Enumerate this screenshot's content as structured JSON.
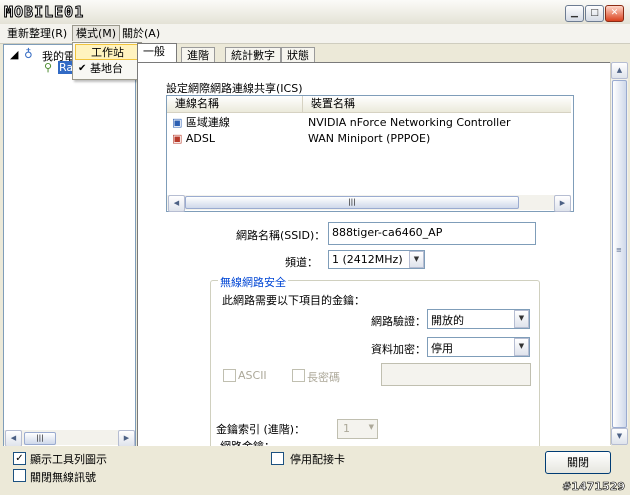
{
  "window": {
    "logo_text": "MOBILE01",
    "controls": [
      "minimize",
      "maximize",
      "close"
    ]
  },
  "menu": {
    "items": [
      "重新整理(R)",
      "模式(M)",
      "關於(A)"
    ],
    "dropdown": [
      "工作站",
      "基地台"
    ]
  },
  "tree": {
    "root": "我的電",
    "child": "Ra"
  },
  "tabs": [
    "一般",
    "進階",
    "統計數字",
    "狀態"
  ],
  "ics": {
    "label": "設定網際網路連線共享(ICS)",
    "columns": [
      "連線名稱",
      "裝置名稱"
    ],
    "rows": [
      {
        "name": "區域連線",
        "device": "NVIDIA nForce Networking Controller"
      },
      {
        "name": "ADSL",
        "device": "WAN Miniport (PPPOE)"
      }
    ]
  },
  "ssid": {
    "label": "網路名稱(SSID)：",
    "value": "888tiger-ca6460_AP"
  },
  "channel": {
    "label": "頻道：",
    "value": "1  (2412MHz)"
  },
  "security": {
    "title": "無線網路安全",
    "desc": "此網路需要以下項目的金鑰：",
    "auth_label": "網路驗證：",
    "auth_value": "開放的",
    "encrypt_label": "資料加密：",
    "encrypt_value": "停用",
    "ascii_label": "ASCII",
    "long_key_label": "長密碼",
    "key_index_label": "金鑰索引 (進階)：",
    "key_index_value": "1",
    "network_key_label": "網路金鑰："
  },
  "bottom": {
    "show_tray_icon": "顯示工具列圖示",
    "disable_radio": "關閉無線訊號",
    "disable_adapter": "停用配接卡",
    "close_button": "關閉"
  },
  "watermark": "#1471529",
  "colors": {
    "accent_border": "#7f9db9",
    "group_title": "#0046d5",
    "menu_highlight": "#fff3bf"
  }
}
